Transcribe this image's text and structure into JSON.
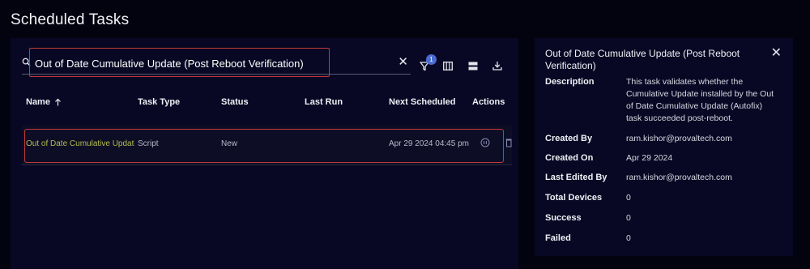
{
  "page": {
    "title": "Scheduled Tasks"
  },
  "search": {
    "value": "Out of Date Cumulative Update (Post Reboot Verification)",
    "clear_icon": "close-icon"
  },
  "toolbar": {
    "filter_count": "1",
    "icons": [
      "filter-icon",
      "columns-icon",
      "density-icon",
      "download-icon"
    ]
  },
  "table": {
    "columns": [
      "Name",
      "Task Type",
      "Status",
      "Last Run",
      "Next Scheduled",
      "Actions"
    ],
    "sort": {
      "column": "Name",
      "direction": "ascending",
      "icon": "arrow-up-icon"
    },
    "rows": [
      {
        "name": "Out of Date Cumulative Update (Post Reboot Verification)",
        "task_type": "Script",
        "status": "New",
        "last_run": "",
        "next_scheduled": "Apr 29 2024 04:45 pm",
        "action_icons": [
          "pause-icon",
          "trash-icon"
        ]
      }
    ]
  },
  "details": {
    "title": "Out of Date Cumulative Update (Post Reboot Verification)",
    "close_icon": "close-icon",
    "description_label": "Description",
    "description": "This task validates whether the Cumulative Update installed by the Out of Date Cumulative Update (Autofix) task succeeded post-reboot.",
    "created_by_label": "Created By",
    "created_by": "ram.kishor@provaltech.com",
    "created_on_label": "Created On",
    "created_on": "Apr 29 2024",
    "last_edited_by_label": "Last Edited By",
    "last_edited_by": "ram.kishor@provaltech.com",
    "total_devices_label": "Total Devices",
    "total_devices": "0",
    "success_label": "Success",
    "success": "0",
    "failed_label": "Failed",
    "failed": "0"
  },
  "colors": {
    "background": "#03030f",
    "panel": "#080824",
    "highlight_border": "#c23a3a",
    "name_text": "#b5bd4c",
    "accent": "#4c6bd1"
  }
}
